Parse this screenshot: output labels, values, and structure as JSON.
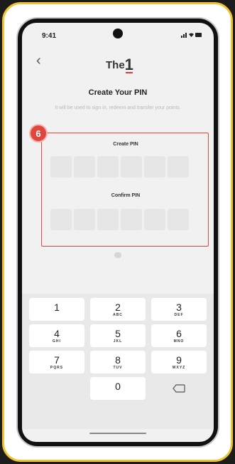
{
  "status_bar": {
    "time": "9:41",
    "icons": "…ᵃ ■"
  },
  "header": {
    "back_symbol": "‹",
    "logo_text": "The",
    "logo_mark": "1"
  },
  "title": "Create Your PIN",
  "subtitle": "It will be used to sign in, redeem and transfer your points.",
  "step_badge": "6",
  "pin": {
    "create_label": "Create PIN",
    "confirm_label": "Confirm PIN",
    "digit_count": 6
  },
  "keypad": [
    {
      "digit": "1",
      "letters": ""
    },
    {
      "digit": "2",
      "letters": "ABC"
    },
    {
      "digit": "3",
      "letters": "DEF"
    },
    {
      "digit": "4",
      "letters": "GHI"
    },
    {
      "digit": "5",
      "letters": "JKL"
    },
    {
      "digit": "6",
      "letters": "MNO"
    },
    {
      "digit": "7",
      "letters": "PQRS"
    },
    {
      "digit": "8",
      "letters": "TUV"
    },
    {
      "digit": "9",
      "letters": "WXYZ"
    },
    {
      "digit": "0",
      "letters": ""
    }
  ],
  "colors": {
    "frame": "#f2c230",
    "accent": "#e0473c"
  }
}
